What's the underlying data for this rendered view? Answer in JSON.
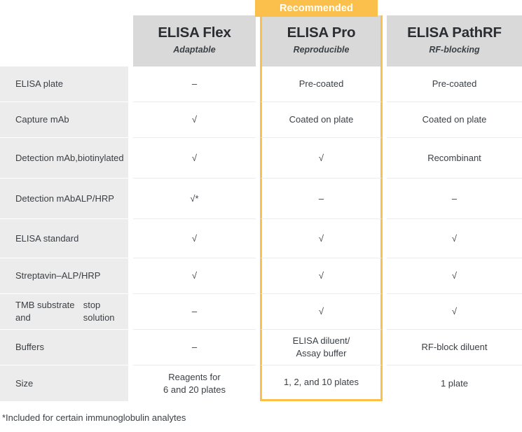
{
  "ribbon": {
    "label": "Recommended",
    "color": "#fbc04b",
    "text_color": "#ffffff",
    "applies_to_column": "ELISA Pro"
  },
  "colors": {
    "accent": "#fbc04b",
    "header_bg": "#d9d9d9",
    "row_label_bg": "#ececec",
    "cell_bg": "#ffffff",
    "text": "#3b4045"
  },
  "table": {
    "row_header_label": "",
    "columns": [
      {
        "title": "ELISA Flex",
        "subtitle": "Adaptable",
        "highlighted": false
      },
      {
        "title": "ELISA Pro",
        "subtitle": "Reproducible",
        "highlighted": true
      },
      {
        "title": "ELISA PathRF",
        "subtitle": "RF-blocking",
        "highlighted": false
      }
    ],
    "rows": [
      {
        "label": "ELISA plate",
        "values": [
          "–",
          "Pre-coated",
          "Pre-coated"
        ]
      },
      {
        "label": "Capture mAb",
        "values": [
          "√",
          "Coated on plate",
          "Coated on plate"
        ]
      },
      {
        "label": "Detection mAb, biotinylated",
        "label_lines": [
          "Detection mAb,",
          "biotinylated"
        ],
        "values": [
          "√",
          "√",
          "Recombinant"
        ]
      },
      {
        "label": "Detection mAb ALP/HRP",
        "label_lines": [
          "Detection mAb",
          "ALP/HRP"
        ],
        "values": [
          "√*",
          "–",
          "–"
        ]
      },
      {
        "label": "ELISA standard",
        "values": [
          "√",
          "√",
          "√"
        ]
      },
      {
        "label": "Streptavin–ALP/HRP",
        "values": [
          "√",
          "√",
          "√"
        ]
      },
      {
        "label": "TMB substrate and stop solution",
        "label_lines": [
          "TMB substrate and",
          "stop solution"
        ],
        "values": [
          "–",
          "√",
          "√"
        ]
      },
      {
        "label": "Buffers",
        "values": [
          "–",
          "ELISA diluent/ Assay buffer",
          "RF-block diluent"
        ],
        "value_lines": [
          [
            "–"
          ],
          [
            "ELISA diluent/",
            "Assay buffer"
          ],
          [
            "RF-block diluent"
          ]
        ]
      },
      {
        "label": "Size",
        "values": [
          "Reagents for 6 and 20 plates",
          "1, 2, and 10 plates",
          "1 plate"
        ],
        "value_lines": [
          [
            "Reagents for",
            "6 and 20 plates"
          ],
          [
            "1, 2, and 10 plates"
          ],
          [
            "1 plate"
          ]
        ]
      }
    ]
  },
  "footnote": "*Included for certain immunoglobulin analytes"
}
